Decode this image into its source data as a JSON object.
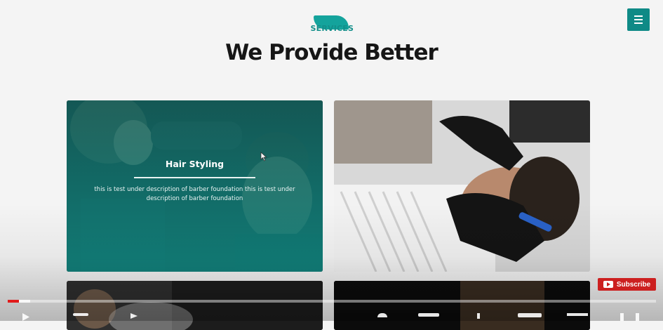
{
  "header": {
    "tagline": "SERVICES",
    "title": "We Provide Better"
  },
  "nav": {
    "menu_icon": "hamburger-menu-icon"
  },
  "colors": {
    "accent": "#0f8a86",
    "subscribe": "#cc1f1f",
    "progress_played": "#e21b1b"
  },
  "services": [
    {
      "title": "Hair Styling",
      "description": "this is test under description of barber foundation this is test under description of barber foundation"
    }
  ],
  "video_player": {
    "subscribe_label": "Subscribe",
    "progress": 0.017,
    "buffered": 0.035
  }
}
